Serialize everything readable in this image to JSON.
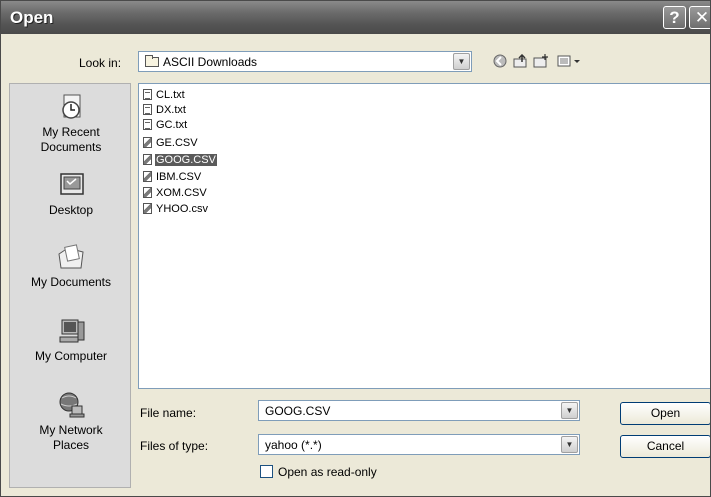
{
  "window": {
    "title": "Open"
  },
  "titlebar_buttons": {
    "help": "?",
    "close": "✕"
  },
  "lookin": {
    "label": "Look in:",
    "value": "ASCII Downloads"
  },
  "places": [
    {
      "label": "My Recent\nDocuments",
      "icon": "recent-documents-icon"
    },
    {
      "label": "Desktop",
      "icon": "desktop-icon"
    },
    {
      "label": "My Documents",
      "icon": "my-documents-icon"
    },
    {
      "label": "My Computer",
      "icon": "my-computer-icon"
    },
    {
      "label": "My Network\nPlaces",
      "icon": "network-places-icon"
    }
  ],
  "files": [
    {
      "name": "CL.txt",
      "type": "txt",
      "selected": false
    },
    {
      "name": "DX.txt",
      "type": "txt",
      "selected": false
    },
    {
      "name": "GC.txt",
      "type": "txt",
      "selected": false
    },
    {
      "name": "GE.CSV",
      "type": "csv",
      "selected": false
    },
    {
      "name": "GOOG.CSV",
      "type": "csv",
      "selected": true
    },
    {
      "name": "IBM.CSV",
      "type": "csv",
      "selected": false
    },
    {
      "name": "XOM.CSV",
      "type": "csv",
      "selected": false
    },
    {
      "name": "YHOO.csv",
      "type": "csv",
      "selected": false
    }
  ],
  "filename": {
    "label": "File name:",
    "value": "GOOG.CSV"
  },
  "filetype": {
    "label": "Files of type:",
    "value": "yahoo (*.*)"
  },
  "readonly": {
    "label": "Open as read-only",
    "checked": false
  },
  "buttons": {
    "open": "Open",
    "cancel": "Cancel"
  }
}
